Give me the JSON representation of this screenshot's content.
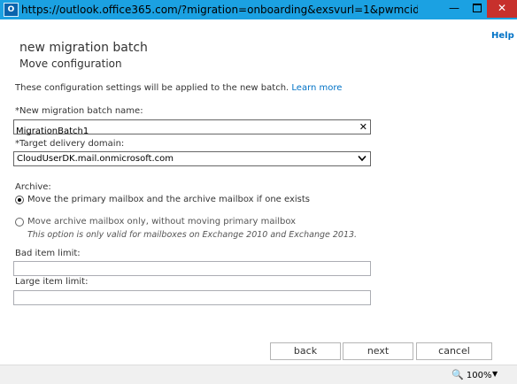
{
  "window": {
    "app_icon_text": "O",
    "title": "https://outlook.office365.com/?migration=onboarding&exsvurl=1&pwmcid=1&ReturnOb...",
    "minimize": "—",
    "close": "✕"
  },
  "help_label": "Help",
  "page": {
    "title": "new migration batch",
    "subtitle": "Move configuration",
    "info_text": "These configuration settings will be applied to the new batch.",
    "learn_more": "Learn more"
  },
  "fields": {
    "batch_name_label": "*New migration batch name:",
    "batch_name_value": "MigrationBatch1",
    "target_domain_label": "*Target delivery domain:",
    "target_domain_value": "CloudUserDK.mail.onmicrosoft.com",
    "archive_label": "Archive:",
    "archive_option_1": "Move the primary mailbox and the archive mailbox if one exists",
    "archive_option_2": "Move archive mailbox only, without moving primary mailbox",
    "archive_note": "This option is only valid for mailboxes on Exchange 2010 and Exchange 2013.",
    "bad_item_label": "Bad item limit:",
    "bad_item_value": "",
    "large_item_label": "Large item limit:",
    "large_item_value": ""
  },
  "buttons": {
    "back": "back",
    "next": "next",
    "cancel": "cancel"
  },
  "status": {
    "zoom": "100%",
    "zoom_icon": "🔍"
  },
  "colors": {
    "titlebar": "#1ba1e2",
    "close_button": "#c7302c",
    "link": "#0072c6"
  },
  "icons": {
    "clear": "✕",
    "dropdown": "chevron-down-icon",
    "zoom_caret": "▼"
  }
}
